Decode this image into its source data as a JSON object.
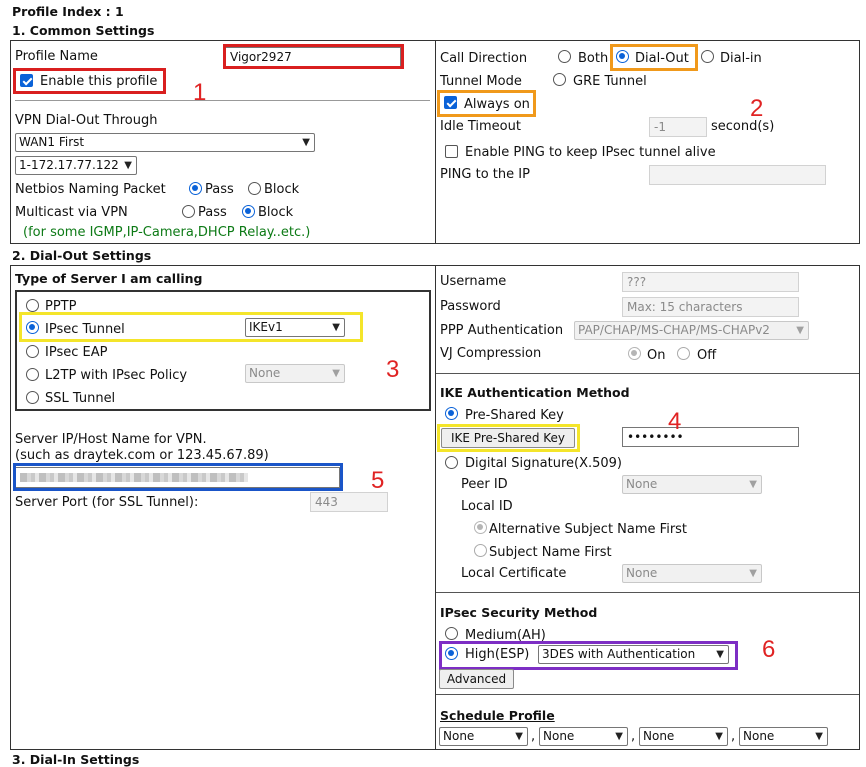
{
  "profile_index": "Profile Index : 1",
  "sec1_title": "1. Common Settings",
  "sec2_title": "2. Dial-Out Settings",
  "sec3_title": "3. Dial-In Settings",
  "common": {
    "profile_name_label": "Profile Name",
    "profile_name_value": "Vigor2927",
    "enable_label": "Enable this profile",
    "dialout_through_label": "VPN Dial-Out Through",
    "wan_value": "WAN1 First",
    "ip_value": "1-172.17.77.122",
    "netbios_label": "Netbios Naming Packet",
    "netbios_pass": "Pass",
    "netbios_block": "Block",
    "multicast_label": "Multicast via VPN",
    "multicast_pass": "Pass",
    "multicast_block": "Block",
    "multicast_note": "(for some IGMP,IP-Camera,DHCP Relay..etc.)",
    "call_direction_label": "Call Direction",
    "dir_both": "Both",
    "dir_dialout": "Dial-Out",
    "dir_dialin": "Dial-in",
    "tunnel_mode_label": "Tunnel Mode",
    "gre_label": "GRE Tunnel",
    "always_on_label": "Always on",
    "idle_timeout_label": "Idle Timeout",
    "idle_timeout_value": "-1",
    "idle_unit": "second(s)",
    "ping_enable_label": "Enable PING to keep IPsec tunnel alive",
    "ping_ip_label": "PING to the IP"
  },
  "dialout": {
    "server_type_title": "Type of Server I am calling",
    "pptp": "PPTP",
    "ipsec_tunnel": "IPsec Tunnel",
    "ike_version": "IKEv1",
    "ipsec_eap": "IPsec EAP",
    "l2tp": "L2TP with IPsec Policy",
    "l2tp_policy": "None",
    "ssl_tunnel": "SSL Tunnel",
    "server_host_label": "Server IP/Host Name for VPN.",
    "server_host_hint": "(such as draytek.com or 123.45.67.89)",
    "server_port_label": "Server Port (for SSL Tunnel):",
    "server_port_value": "443",
    "username_label": "Username",
    "username_value": "???",
    "password_label": "Password",
    "password_placeholder": "Max: 15 characters",
    "ppp_auth_label": "PPP Authentication",
    "ppp_auth_value": "PAP/CHAP/MS-CHAP/MS-CHAPv2",
    "vj_label": "VJ Compression",
    "vj_on": "On",
    "vj_off": "Off",
    "ike_auth_title": "IKE Authentication Method",
    "psk_label": "Pre-Shared Key",
    "psk_button": "IKE Pre-Shared Key",
    "psk_value": "••••••••",
    "digital_sig": "Digital Signature(X.509)",
    "peer_id_label": "Peer ID",
    "peer_id_value": "None",
    "local_id_label": "Local ID",
    "alt_subject": "Alternative Subject Name First",
    "subject_first": "Subject Name First",
    "local_cert_label": "Local Certificate",
    "local_cert_value": "None",
    "ipsec_sec_title": "IPsec Security Method",
    "medium_ah": "Medium(AH)",
    "high_esp": "High(ESP)",
    "esp_value": "3DES with Authentication",
    "advanced_button": "Advanced",
    "schedule_title": "Schedule Profile",
    "schedule_values": [
      "None",
      "None",
      "None",
      "None"
    ]
  },
  "markers": [
    "1",
    "2",
    "3",
    "4",
    "5",
    "6"
  ],
  "colors": {
    "marker_red": "#d91f1f",
    "marker_orange": "#f0991b",
    "marker_yellow": "#f4e52a",
    "marker_blue": "#1a55c8",
    "marker_purple": "#7d2ec4",
    "note_green": "#0d7a16",
    "radio_blue": "#0a62d8"
  }
}
